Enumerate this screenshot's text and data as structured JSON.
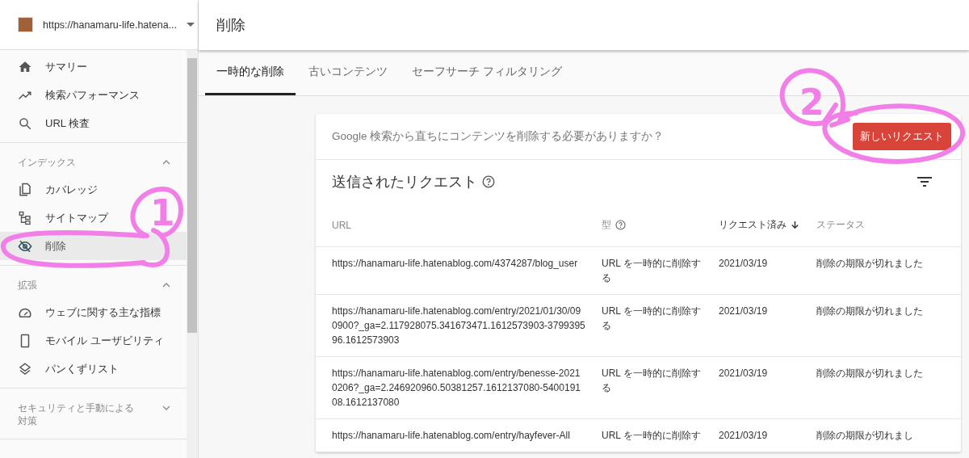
{
  "property": {
    "url": "https://hanamaru-life.hatena..."
  },
  "sidebar": {
    "items": [
      {
        "label": "サマリー",
        "selected": false
      },
      {
        "label": "検索パフォーマンス",
        "selected": false
      },
      {
        "label": "URL 検査",
        "selected": false
      }
    ],
    "sections": [
      {
        "title": "インデックス",
        "expanded": true,
        "items": [
          {
            "label": "カバレッジ",
            "selected": false
          },
          {
            "label": "サイトマップ",
            "selected": false
          },
          {
            "label": "削除",
            "selected": true
          }
        ]
      },
      {
        "title": "拡張",
        "expanded": true,
        "items": [
          {
            "label": "ウェブに関する主な指標",
            "selected": false
          },
          {
            "label": "モバイル ユーザビリティ",
            "selected": false
          },
          {
            "label": "パンくずリスト",
            "selected": false
          }
        ]
      },
      {
        "title": "セキュリティと手動による対策",
        "expanded": false
      }
    ]
  },
  "page_title": "削除",
  "tabs": [
    {
      "label": "一時的な削除",
      "selected": true
    },
    {
      "label": "古いコンテンツ",
      "selected": false
    },
    {
      "label": "セーフサーチ フィルタリング",
      "selected": false
    }
  ],
  "card": {
    "prompt": "Google 検索から直ちにコンテンツを削除する必要がありますか？",
    "new_request_button": "新しいリクエスト",
    "title": "送信されたリクエスト",
    "columns": [
      {
        "label": "URL",
        "help": false,
        "sorted": false
      },
      {
        "label": "型",
        "help": true,
        "sorted": false
      },
      {
        "label": "リクエスト済み",
        "help": false,
        "sorted": true
      },
      {
        "label": "ステータス",
        "help": false,
        "sorted": false
      }
    ],
    "rows": [
      [
        "https://hanamaru-life.hatenablog.com/4374287/blog_user",
        "URL を一時的に削除する",
        "2021/03/19",
        "削除の期限が切れました"
      ],
      [
        "https://hanamaru-life.hatenablog.com/entry/2021/01/30/090900?_ga=2.117928075.341673471.1612573903-379939596.1612573903",
        "URL を一時的に削除する",
        "2021/03/19",
        "削除の期限が切れました"
      ],
      [
        "https://hanamaru-life.hatenablog.com/entry/benesse-20210206?_ga=2.246920960.50381257.1612137080-540019108.1612137080",
        "URL を一時的に削除する",
        "2021/03/19",
        "削除の期限が切れました"
      ],
      [
        "https://hanamaru-life.hatenablog.com/entry/hayfever-All",
        "URL を一時的に削除す",
        "2021/03/19",
        "削除の期限が切れまし"
      ]
    ]
  },
  "annotations": [
    {
      "number": "1"
    },
    {
      "number": "2"
    }
  ]
}
